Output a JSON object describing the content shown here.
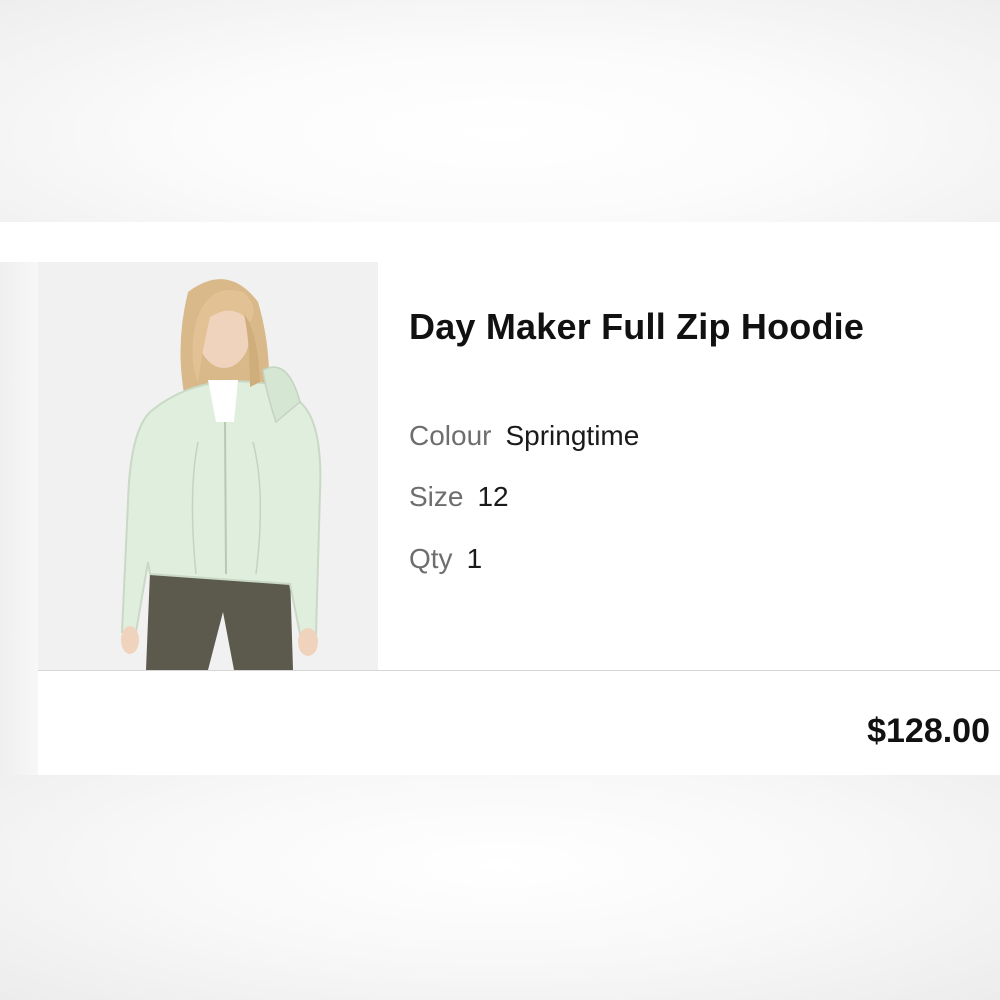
{
  "product": {
    "title": "Day Maker Full Zip Hoodie",
    "photo_icon": "product-photo-model-in-mint-hoodie",
    "attributes": {
      "colour": {
        "label": "Colour",
        "value": "Springtime"
      },
      "size": {
        "label": "Size",
        "value": "12"
      },
      "qty": {
        "label": "Qty",
        "value": "1"
      }
    },
    "price": "$128.00"
  },
  "colors": {
    "hoodie": "#dfeedd",
    "pants": "#5b5a4c",
    "hair": "#d9b889",
    "background": "#ffffff"
  }
}
